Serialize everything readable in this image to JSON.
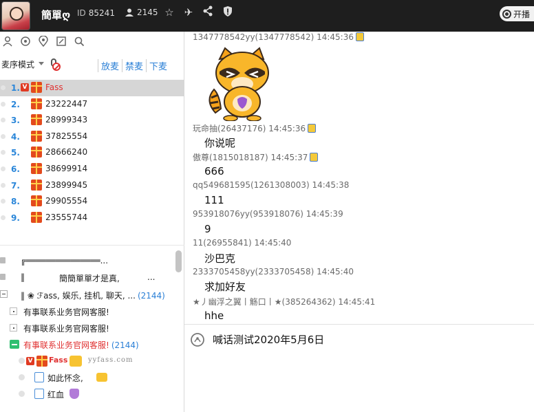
{
  "topbar": {
    "name": "簡單ღ",
    "id_label": "ID",
    "id_value": "85241",
    "member_count": "2145",
    "icons": [
      "star-icon",
      "airplane-icon",
      "share-icon",
      "shield-icon"
    ],
    "start_button": "开播"
  },
  "left_tools": [
    "users-icon",
    "refresh-icon",
    "location-icon",
    "edit-board-icon",
    "search-icon"
  ],
  "mic_mode": {
    "label": "麦序模式",
    "links": [
      "放麦",
      "禁麦",
      "下麦"
    ]
  },
  "queue": [
    {
      "num": "1.",
      "name": "Fass",
      "vip": "V",
      "selected": true
    },
    {
      "num": "2.",
      "name": "23222447"
    },
    {
      "num": "3.",
      "name": "28999343"
    },
    {
      "num": "4.",
      "name": "37825554"
    },
    {
      "num": "5.",
      "name": "28666240"
    },
    {
      "num": "6.",
      "name": "38699914"
    },
    {
      "num": "7.",
      "name": "23899945"
    },
    {
      "num": "8.",
      "name": "29905554"
    },
    {
      "num": "9.",
      "name": "23555744"
    }
  ],
  "tree": {
    "r1": "╔═══════════════...",
    "r2_a": "‖",
    "r2_b": "簡簡單單才是真,",
    "r2_c": "...",
    "r3_text": "‖ ❀ ℱass, 娱乐, 挂机, 聊天, ...",
    "r3_count": "(2144)",
    "r4": "有事联系业务官网客服!",
    "r5": "有事联系业务官网客服!",
    "r6": "有事联系业务官网客服!",
    "r6_count": "(2144)",
    "u1_vip": "V",
    "u1_name": "Fass",
    "u1_watermark": "yyfass.com",
    "u2_name": "如此怀念,",
    "u3_name": "红血"
  },
  "chat": [
    {
      "head": "1347778542yy(1347778542) 14:45:36",
      "body": "",
      "badge": true
    },
    {
      "head": "玩命抽(26437176) 14:45:36",
      "body": "你说呢",
      "badge": true
    },
    {
      "head": "傲尊(1815018187) 14:45:37",
      "body": "666",
      "badge": true
    },
    {
      "head": "qq549681595(1261308003) 14:45:38",
      "body": "111",
      "badge": false
    },
    {
      "head": "953918076yy(953918076) 14:45:39",
      "body": "9",
      "badge": false
    },
    {
      "head": "11(26955841) 14:45:40",
      "body": "沙巴克",
      "badge": false
    },
    {
      "head": "2333705458yy(2333705458) 14:45:40",
      "body": "求加好友",
      "badge": false
    },
    {
      "head": "★丿幽浮之翼丨觞口丨★(385264362) 14:45:41",
      "body": "hhe",
      "badge": false
    }
  ],
  "shout": {
    "text": "喊话测试2020年5月6日"
  },
  "colors": {
    "topbar_bg": "#1e1e1e",
    "queue_number": "#2a86d9",
    "link_blue": "#2a7fd6",
    "alert_red": "#e03131"
  }
}
